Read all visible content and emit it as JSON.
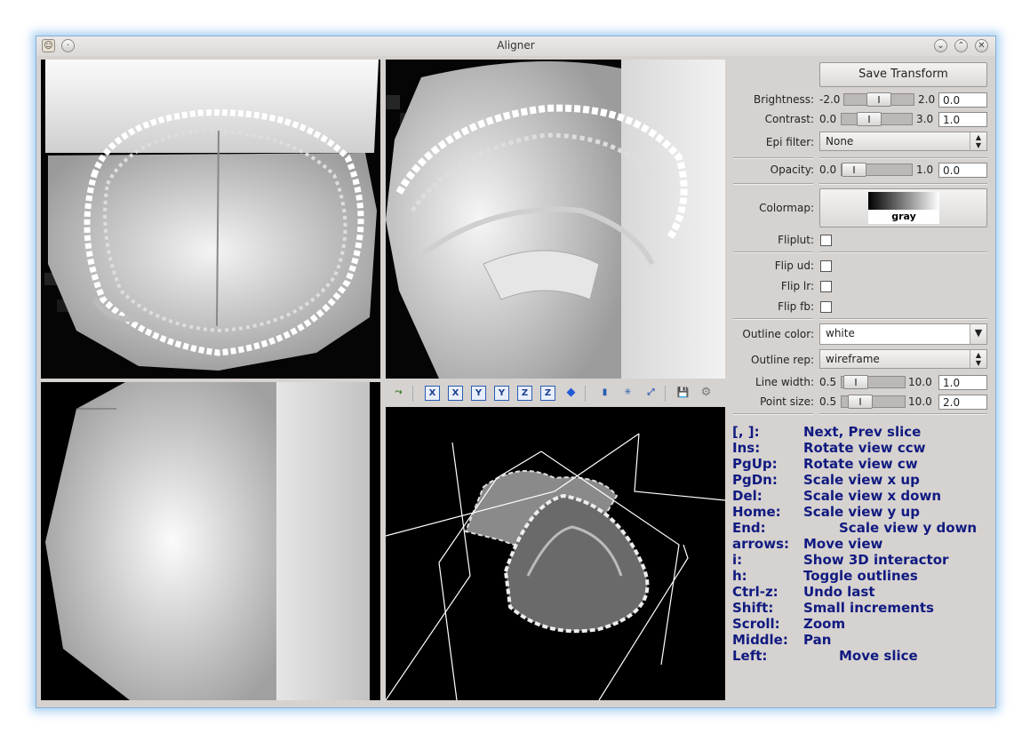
{
  "window": {
    "title": "Aligner"
  },
  "toolbar3d": {
    "buttons": [
      {
        "name": "reset-interactor-icon",
        "glyph": "⤳"
      },
      {
        "name": "view-x-pos-button",
        "glyph": "X"
      },
      {
        "name": "view-x-neg-button",
        "glyph": "X"
      },
      {
        "name": "view-y-pos-button",
        "glyph": "Y"
      },
      {
        "name": "view-y-neg-button",
        "glyph": "Y"
      },
      {
        "name": "view-z-pos-button",
        "glyph": "Z"
      },
      {
        "name": "view-z-neg-button",
        "glyph": "Z"
      },
      {
        "name": "isometric-cube-icon",
        "glyph": "◆"
      },
      {
        "name": "parallel-projection-icon",
        "glyph": "▮"
      },
      {
        "name": "orientation-axes-icon",
        "glyph": "✳"
      },
      {
        "name": "fit-view-icon",
        "glyph": "⤢"
      },
      {
        "name": "save-screenshot-icon",
        "glyph": "💾"
      },
      {
        "name": "settings-gear-icon",
        "glyph": "⚙"
      }
    ]
  },
  "controls": {
    "save_transform": "Save Transform",
    "brightness": {
      "label": "Brightness:",
      "min": "-2.0",
      "max": "2.0",
      "value": "0.0",
      "level": 0.5
    },
    "contrast": {
      "label": "Contrast:",
      "min": "0.0",
      "max": "3.0",
      "value": "1.0",
      "level": 0.33
    },
    "epi_filter": {
      "label": "Epi filter:",
      "value": "None"
    },
    "opacity": {
      "label": "Opacity:",
      "min": "0.0",
      "max": "1.0",
      "value": "0.0",
      "level": 0.0
    },
    "colormap": {
      "label": "Colormap:",
      "value": "gray"
    },
    "fliplut": {
      "label": "Fliplut:"
    },
    "flip_ud": {
      "label": "Flip ud:"
    },
    "flip_lr": {
      "label": "Flip lr:"
    },
    "flip_fb": {
      "label": "Flip fb:"
    },
    "outline_color": {
      "label": "Outline color:",
      "value": "white"
    },
    "outline_rep": {
      "label": "Outline rep:",
      "value": "wireframe"
    },
    "line_width": {
      "label": "Line width:",
      "min": "0.5",
      "max": "10.0",
      "value": "1.0",
      "level": 0.05
    },
    "point_size": {
      "label": "Point size:",
      "min": "0.5",
      "max": "10.0",
      "value": "2.0",
      "level": 0.16
    }
  },
  "help": [
    {
      "key": "[, ]:",
      "desc": "Next, Prev slice"
    },
    {
      "key": "Ins:",
      "desc": "Rotate view ccw"
    },
    {
      "key": "PgUp:",
      "desc": "Rotate view cw"
    },
    {
      "key": "PgDn:",
      "desc": "Scale view x up"
    },
    {
      "key": "Del:",
      "desc": "Scale view x down"
    },
    {
      "key": "Home:",
      "desc": "Scale view y up"
    },
    {
      "key": "End:",
      "desc": "Scale view y down"
    },
    {
      "key": "arrows:",
      "desc": "Move view"
    },
    {
      "key": "i:",
      "desc": "Show 3D interactor"
    },
    {
      "key": "h:",
      "desc": "Toggle outlines"
    },
    {
      "key": "Ctrl-z:",
      "desc": "Undo last"
    },
    {
      "key": "Shift:",
      "desc": "Small increments"
    },
    {
      "key": "Scroll:",
      "desc": "Zoom"
    },
    {
      "key": "Middle:",
      "desc": "Pan"
    },
    {
      "key": "Left:",
      "desc": "Move slice"
    }
  ]
}
